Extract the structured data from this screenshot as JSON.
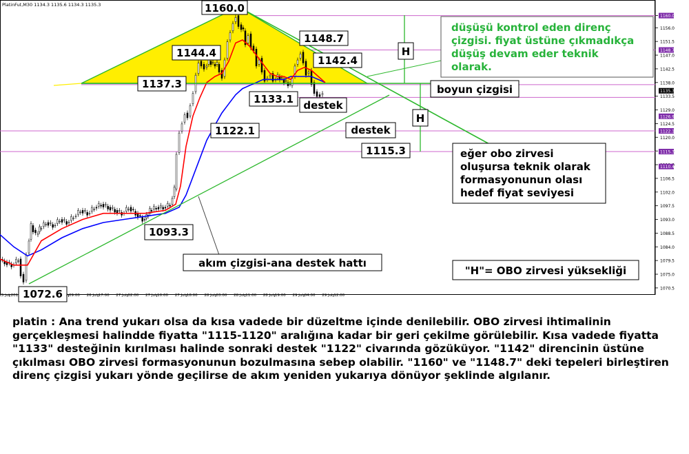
{
  "chart_data": {
    "type": "candlestick",
    "symbol_header": "PlatinFut,M30  1134.3 1135.6 1134.3 1135.3",
    "x_tick_labels": [
      "25 Jul 2016",
      "26 Jul 01:00",
      "26 Jul 09:00",
      "26 Jul 17:00",
      "27 Jul 02:00",
      "27 Jul 10:00",
      "27 Jul 18:00",
      "28 Jul 03:00",
      "28 Jul 11:00",
      "28 Jul 19:00",
      "29 Jul 04:00",
      "29 Jul 12:00"
    ],
    "y_tick_labels": [
      1160.0,
      1156.0,
      1151.5,
      1147.0,
      1142.5,
      1138.0,
      1133.5,
      1129.0,
      1124.5,
      1120.0,
      1115.5,
      1111.0,
      1106.5,
      1102.0,
      1097.5,
      1093.0,
      1088.5,
      1084.0,
      1079.5,
      1075.0,
      1070.5
    ],
    "ylim": [
      1069.5,
      1163.0
    ],
    "price_path": [
      [
        0,
        1080
      ],
      [
        10,
        1079
      ],
      [
        20,
        1078
      ],
      [
        30,
        1080
      ],
      [
        34,
        1075
      ],
      [
        38,
        1073
      ],
      [
        42,
        1082
      ],
      [
        48,
        1091
      ],
      [
        55,
        1088
      ],
      [
        60,
        1090
      ],
      [
        70,
        1092
      ],
      [
        80,
        1091
      ],
      [
        90,
        1093
      ],
      [
        100,
        1092
      ],
      [
        110,
        1094
      ],
      [
        120,
        1096
      ],
      [
        130,
        1095
      ],
      [
        140,
        1097
      ],
      [
        150,
        1098
      ],
      [
        160,
        1097
      ],
      [
        170,
        1096
      ],
      [
        180,
        1095
      ],
      [
        190,
        1097
      ],
      [
        200,
        1095
      ],
      [
        210,
        1093
      ],
      [
        215,
        1094
      ],
      [
        220,
        1096
      ],
      [
        230,
        1097
      ],
      [
        240,
        1097
      ],
      [
        250,
        1098
      ],
      [
        256,
        1103
      ],
      [
        260,
        1115
      ],
      [
        264,
        1122
      ],
      [
        268,
        1125
      ],
      [
        272,
        1128
      ],
      [
        276,
        1127
      ],
      [
        280,
        1131
      ],
      [
        284,
        1135
      ],
      [
        288,
        1141
      ],
      [
        292,
        1145
      ],
      [
        296,
        1144
      ],
      [
        300,
        1143
      ],
      [
        306,
        1145
      ],
      [
        312,
        1144
      ],
      [
        318,
        1144
      ],
      [
        322,
        1142
      ],
      [
        326,
        1140
      ],
      [
        330,
        1146
      ],
      [
        334,
        1152
      ],
      [
        338,
        1155
      ],
      [
        342,
        1158
      ],
      [
        346,
        1160
      ],
      [
        350,
        1157
      ],
      [
        356,
        1155
      ],
      [
        360,
        1151
      ],
      [
        364,
        1154
      ],
      [
        368,
        1150
      ],
      [
        372,
        1149
      ],
      [
        376,
        1144
      ],
      [
        380,
        1146
      ],
      [
        384,
        1142
      ],
      [
        388,
        1139
      ],
      [
        392,
        1140
      ],
      [
        396,
        1141
      ],
      [
        400,
        1139
      ],
      [
        406,
        1140
      ],
      [
        412,
        1139
      ],
      [
        418,
        1138
      ],
      [
        424,
        1137
      ],
      [
        428,
        1140
      ],
      [
        432,
        1144
      ],
      [
        436,
        1146
      ],
      [
        440,
        1148
      ],
      [
        444,
        1145
      ],
      [
        448,
        1141
      ],
      [
        452,
        1142
      ],
      [
        456,
        1138
      ],
      [
        460,
        1135
      ],
      [
        464,
        1134
      ],
      [
        468,
        1134
      ],
      [
        472,
        1135
      ]
    ],
    "ma_red": [
      [
        0,
        1080
      ],
      [
        20,
        1078
      ],
      [
        40,
        1078
      ],
      [
        60,
        1086
      ],
      [
        90,
        1090
      ],
      [
        120,
        1093
      ],
      [
        150,
        1095
      ],
      [
        180,
        1095
      ],
      [
        210,
        1095
      ],
      [
        240,
        1096
      ],
      [
        255,
        1098
      ],
      [
        262,
        1104
      ],
      [
        270,
        1117
      ],
      [
        280,
        1127
      ],
      [
        290,
        1133
      ],
      [
        300,
        1138
      ],
      [
        312,
        1140
      ],
      [
        322,
        1141
      ],
      [
        332,
        1145
      ],
      [
        342,
        1151
      ],
      [
        352,
        1152
      ],
      [
        362,
        1150
      ],
      [
        372,
        1147
      ],
      [
        382,
        1144
      ],
      [
        392,
        1141
      ],
      [
        402,
        1140
      ],
      [
        412,
        1140
      ],
      [
        422,
        1139
      ],
      [
        432,
        1142
      ],
      [
        442,
        1143
      ],
      [
        452,
        1142
      ],
      [
        462,
        1140
      ],
      [
        472,
        1138
      ]
    ],
    "ma_blue": [
      [
        0,
        1088
      ],
      [
        20,
        1084
      ],
      [
        40,
        1081
      ],
      [
        60,
        1083
      ],
      [
        90,
        1087
      ],
      [
        120,
        1090
      ],
      [
        150,
        1092
      ],
      [
        180,
        1093
      ],
      [
        210,
        1094
      ],
      [
        240,
        1095
      ],
      [
        260,
        1097
      ],
      [
        270,
        1101
      ],
      [
        280,
        1107
      ],
      [
        290,
        1113
      ],
      [
        300,
        1119
      ],
      [
        312,
        1124
      ],
      [
        322,
        1128
      ],
      [
        332,
        1131
      ],
      [
        342,
        1134
      ],
      [
        352,
        1136
      ],
      [
        362,
        1137
      ],
      [
        372,
        1138
      ],
      [
        382,
        1139
      ],
      [
        392,
        1139
      ],
      [
        402,
        1139
      ],
      [
        412,
        1139
      ],
      [
        422,
        1140
      ],
      [
        432,
        1140
      ],
      [
        442,
        1140
      ],
      [
        452,
        1140
      ],
      [
        462,
        1139
      ],
      [
        472,
        1138
      ]
    ],
    "horizontal_levels": [
      1160.0,
      1148.7,
      1137.3,
      1133.1,
      1122.1,
      1115.3
    ],
    "right_axis_price_tags": [
      "1160.0",
      "1148.7",
      "1135.3",
      "1126.9",
      "1122.1",
      "1115.3",
      "1110.4"
    ],
    "annotations": {
      "p1160": "1160.0",
      "p1148": "1148.7",
      "p1144": "1144.4",
      "p1142": "1142.4",
      "p1137": "1137.3",
      "p1133": "1133.1",
      "p1122": "1122.1",
      "p1115": "1115.3",
      "p1093": "1093.3",
      "p1072": "1072.6",
      "destek_near": "destek",
      "destek_far": "destek",
      "boyun": "boyun çizgisi",
      "h_top": "H",
      "h_bottom": "H",
      "direnc_note": [
        "düşüşü kontrol eden direnç",
        "çizgisi. fiyat üstüne çıkmadıkça",
        "düşüş devam eder teknik",
        "olarak."
      ],
      "obo_note": [
        "eğer obo zirvesi",
        "oluşursa teknik olarak",
        "formasyonunun olası",
        "hedef fiyat seviyesi"
      ],
      "trend_note": "akım çizgisi-ana destek hattı",
      "h_legend": "\"H\"= OBO zirvesi yüksekliği"
    }
  },
  "commentary": "platin : Ana trend yukarı olsa da kısa vadede bir düzeltme içinde denilebilir. OBO zirvesi ihtimalinin gerçekleşmesi halindde fiyatta \"1115-1120\" aralığına kadar bir geri çekilme görülebilir. Kısa vadede fiyatta \"1133\" desteğinin kırılması halinde sonraki destek \"1122\" civarında gözüküyor. \"1142\" direncinin üstüne çıkılması OBO zirvesi formasyonunun bozulmasına sebep olabilir. \"1160\" ve \"1148.7\" deki tepeleri birleştiren direnç çizgisi yukarı yönde geçilirse de akım yeniden yukarıya dönüyor şeklinde algılanır.",
  "colors": {
    "triangle_fill": "#ffee00",
    "trend_line": "#2db82d",
    "level_line": "#cc66cc",
    "ma_red": "#ff0000",
    "ma_blue": "#0000ff",
    "note_green": "#27b33a",
    "price_tag_bg": "#7d2aa8"
  }
}
